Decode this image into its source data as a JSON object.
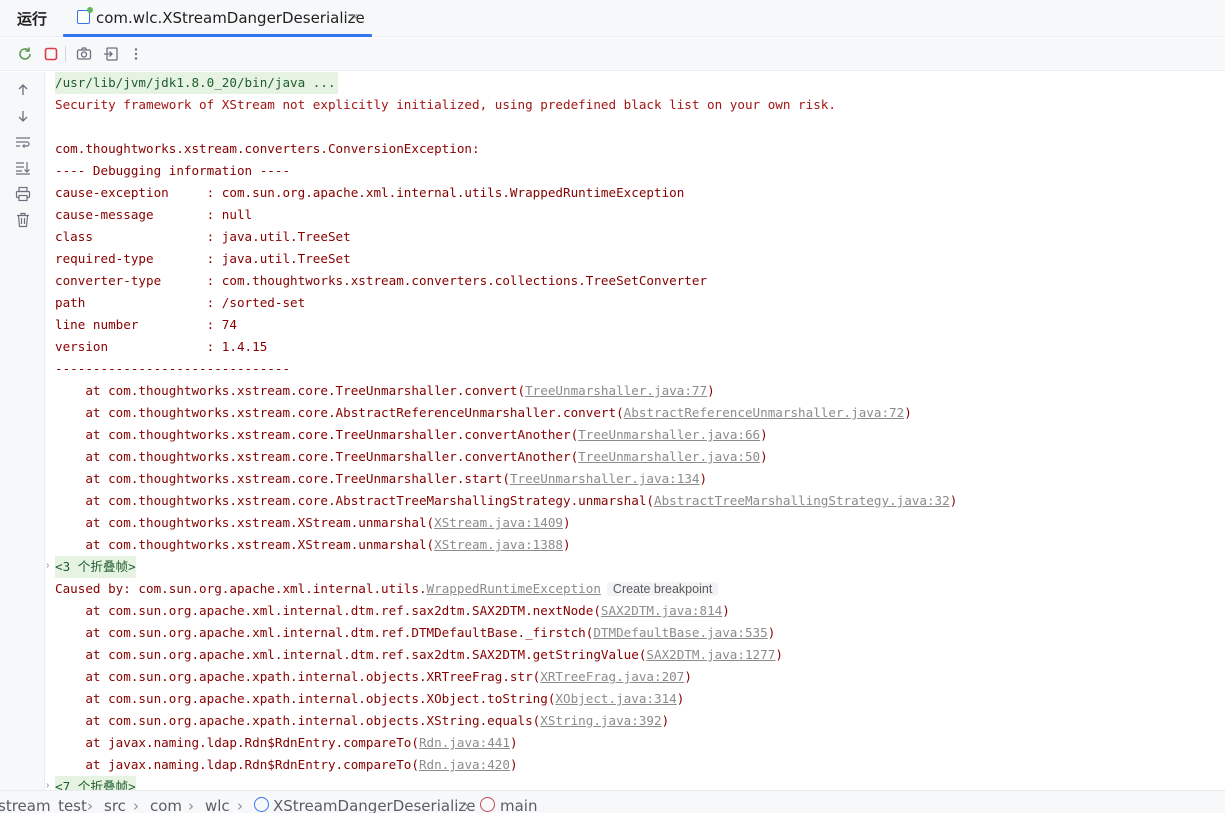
{
  "header": {
    "run_label": "运行",
    "tab_title": "com.wlc.XStreamDangerDeserialize",
    "close_glyph": "×"
  },
  "toolbar": {
    "icons": [
      "rerun-icon",
      "stop-icon",
      "camera-icon",
      "exit-icon",
      "more-icon"
    ]
  },
  "sidebar": {
    "icons": [
      "arrow-up-icon",
      "arrow-down-icon",
      "soft-wrap-icon",
      "scroll-to-end-icon",
      "print-icon",
      "trash-icon"
    ]
  },
  "console": {
    "command": "/usr/lib/jvm/jdk1.8.0_20/bin/java ...",
    "security_warning": "Security framework of XStream not explicitly initialized, using predefined black list on your own risk.",
    "exception": "com.thoughtworks.xstream.converters.ConversionException:",
    "debug_header": "---- Debugging information ----",
    "debug": [
      {
        "text": "cause-exception     : com.sun.org.apache.xml.internal.utils.WrappedRuntimeException"
      },
      {
        "text": "cause-message       : null"
      },
      {
        "text": "class               : java.util.TreeSet"
      },
      {
        "text": "required-type       : java.util.TreeSet"
      },
      {
        "text": "converter-type      : com.thoughtworks.xstream.converters.collections.TreeSetConverter"
      },
      {
        "text": "path                : /sorted-set"
      },
      {
        "text": "line number         : 74"
      },
      {
        "text": "version             : 1.4.15"
      }
    ],
    "debug_footer": "-------------------------------",
    "trace1": [
      {
        "prefix": "    at com.thoughtworks.xstream.core.TreeUnmarshaller.convert(",
        "link": "TreeUnmarshaller.java:77",
        "suffix": ")"
      },
      {
        "prefix": "    at com.thoughtworks.xstream.core.AbstractReferenceUnmarshaller.convert(",
        "link": "AbstractReferenceUnmarshaller.java:72",
        "suffix": ")"
      },
      {
        "prefix": "    at com.thoughtworks.xstream.core.TreeUnmarshaller.convertAnother(",
        "link": "TreeUnmarshaller.java:66",
        "suffix": ")"
      },
      {
        "prefix": "    at com.thoughtworks.xstream.core.TreeUnmarshaller.convertAnother(",
        "link": "TreeUnmarshaller.java:50",
        "suffix": ")"
      },
      {
        "prefix": "    at com.thoughtworks.xstream.core.TreeUnmarshaller.start(",
        "link": "TreeUnmarshaller.java:134",
        "suffix": ")"
      },
      {
        "prefix": "    at com.thoughtworks.xstream.core.AbstractTreeMarshallingStrategy.unmarshal(",
        "link": "AbstractTreeMarshallingStrategy.java:32",
        "suffix": ")"
      },
      {
        "prefix": "    at com.thoughtworks.xstream.XStream.unmarshal(",
        "link": "XStream.java:1409",
        "suffix": ")"
      },
      {
        "prefix": "    at com.thoughtworks.xstream.XStream.unmarshal(",
        "link": "XStream.java:1388",
        "suffix": ")"
      }
    ],
    "fold1": "<3 个折叠帧>",
    "caused_by_prefix": "Caused by: com.sun.org.apache.xml.internal.utils.",
    "caused_by_link": "WrappedRuntimeException",
    "create_breakpoint": "Create breakpoint",
    "trace2": [
      {
        "prefix": "    at com.sun.org.apache.xml.internal.dtm.ref.sax2dtm.SAX2DTM.nextNode(",
        "link": "SAX2DTM.java:814",
        "suffix": ")"
      },
      {
        "prefix": "    at com.sun.org.apache.xml.internal.dtm.ref.DTMDefaultBase._firstch(",
        "link": "DTMDefaultBase.java:535",
        "suffix": ")"
      },
      {
        "prefix": "    at com.sun.org.apache.xml.internal.dtm.ref.sax2dtm.SAX2DTM.getStringValue(",
        "link": "SAX2DTM.java:1277",
        "suffix": ")"
      },
      {
        "prefix": "    at com.sun.org.apache.xpath.internal.objects.XRTreeFrag.str(",
        "link": "XRTreeFrag.java:207",
        "suffix": ")"
      },
      {
        "prefix": "    at com.sun.org.apache.xpath.internal.objects.XObject.toString(",
        "link": "XObject.java:314",
        "suffix": ")"
      },
      {
        "prefix": "    at com.sun.org.apache.xpath.internal.objects.XString.equals(",
        "link": "XString.java:392",
        "suffix": ")"
      },
      {
        "prefix": "    at javax.naming.ldap.Rdn$RdnEntry.compareTo(",
        "link": "Rdn.java:441",
        "suffix": ")"
      },
      {
        "prefix": "    at javax.naming.ldap.Rdn$RdnEntry.compareTo(",
        "link": "Rdn.java:420",
        "suffix": ")"
      }
    ],
    "fold2": "<7 个折叠帧>"
  },
  "breadcrumb": {
    "items": [
      "stream_test",
      "src",
      "com",
      "wlc",
      "XStreamDangerDeserialize",
      "main"
    ],
    "sep": "›"
  }
}
